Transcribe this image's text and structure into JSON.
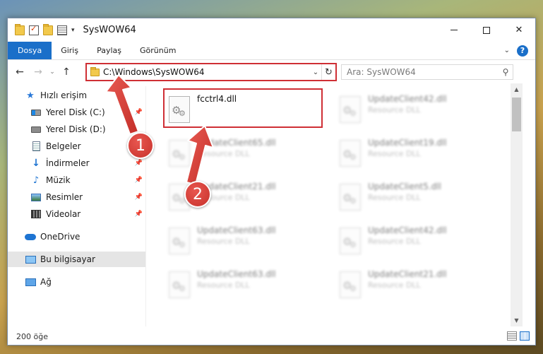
{
  "window": {
    "title": "SysWOW64"
  },
  "ribbon": {
    "tabs": [
      "Dosya",
      "Giriş",
      "Paylaş",
      "Görünüm"
    ],
    "help_label": "?"
  },
  "address": {
    "path": "C:\\Windows\\SysWOW64",
    "search_placeholder": "Ara: SysWOW64"
  },
  "sidebar": {
    "items": [
      {
        "label": "Hızlı erişim",
        "icon": "star-icon"
      },
      {
        "label": "Yerel Disk (C:)",
        "icon": "drive-icon",
        "pinned": true
      },
      {
        "label": "Yerel Disk (D:)",
        "icon": "drive-icon"
      },
      {
        "label": "Belgeler",
        "icon": "document-icon",
        "pinned": true
      },
      {
        "label": "İndirmeler",
        "icon": "download-icon",
        "pinned": true
      },
      {
        "label": "Müzik",
        "icon": "music-icon",
        "pinned": true
      },
      {
        "label": "Resimler",
        "icon": "pictures-icon",
        "pinned": true
      },
      {
        "label": "Videolar",
        "icon": "video-icon",
        "pinned": true
      },
      {
        "label": "OneDrive",
        "icon": "cloud-icon"
      },
      {
        "label": "Bu bilgisayar",
        "icon": "computer-icon",
        "selected": true
      },
      {
        "label": "Ağ",
        "icon": "network-icon"
      }
    ]
  },
  "files": [
    {
      "name": "fcctrl4.dll",
      "type": "",
      "highlighted": true
    },
    {
      "name": "UpdateClient42.dll",
      "type": "Resource DLL"
    },
    {
      "name": "UpdateClient65.dll",
      "type": "Resource DLL"
    },
    {
      "name": "UpdateClient19.dll",
      "type": "Resource DLL"
    },
    {
      "name": "UpdateClient21.dll",
      "type": "Resource DLL"
    },
    {
      "name": "UpdateClient5.dll",
      "type": "Resource DLL"
    },
    {
      "name": "UpdateClient63.dll",
      "type": "Resource DLL"
    },
    {
      "name": "UpdateClient42.dll",
      "type": "Resource DLL"
    },
    {
      "name": "UpdateClient63.dll",
      "type": "Resource DLL"
    },
    {
      "name": "UpdateClient21.dll",
      "type": "Resource DLL"
    }
  ],
  "status": {
    "item_count": "200 öğe"
  },
  "annotations": {
    "step1": "1",
    "step2": "2"
  },
  "colors": {
    "accent": "#1a6fc9",
    "highlight": "#cf2f35"
  }
}
